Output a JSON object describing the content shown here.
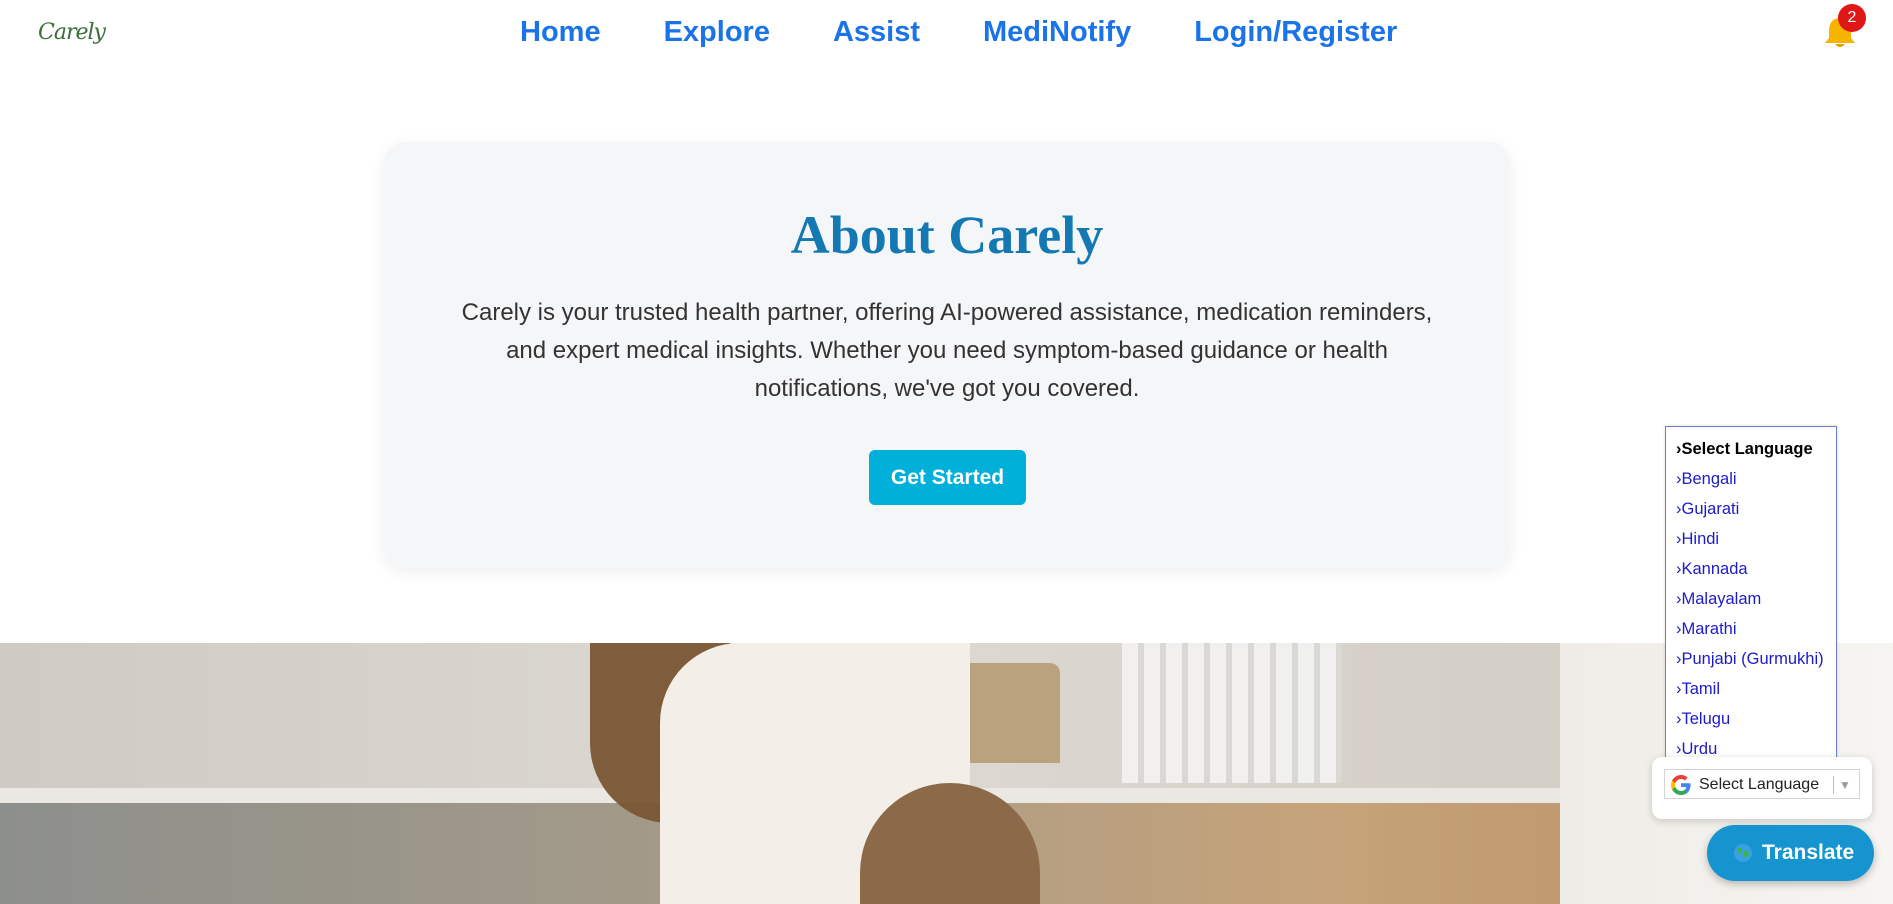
{
  "app": {
    "logo_text": "Carely"
  },
  "nav": {
    "items": [
      {
        "label": "Home"
      },
      {
        "label": "Explore"
      },
      {
        "label": "Assist"
      },
      {
        "label": "MediNotify"
      },
      {
        "label": "Login/Register"
      }
    ],
    "notification_count": "2"
  },
  "about": {
    "title": "About Carely",
    "description": "Carely is your trusted health partner, offering AI-powered assistance, medication reminders, and expert medical insights. Whether you need symptom-based guidance or health notifications, we've got you covered.",
    "cta_label": "Get Started"
  },
  "language_menu": {
    "items": [
      "›Select Language",
      "›Bengali",
      "›Gujarati",
      "›Hindi",
      "›Kannada",
      "›Malayalam",
      "›Marathi",
      "›Punjabi (Gurmukhi)",
      "›Tamil",
      "›Telugu",
      "›Urdu"
    ]
  },
  "translate_widget": {
    "select_label": "Select Language",
    "dropdown_arrow": "▼",
    "button_label": "Translate",
    "button_icon": "globe-icon"
  },
  "colors": {
    "nav_link": "#1a73e8",
    "about_title": "#1479b3",
    "cta_bg": "#00b0d8",
    "translate_bg": "#1694cf",
    "badge_bg": "#e01717",
    "bell": "#f5b400"
  }
}
